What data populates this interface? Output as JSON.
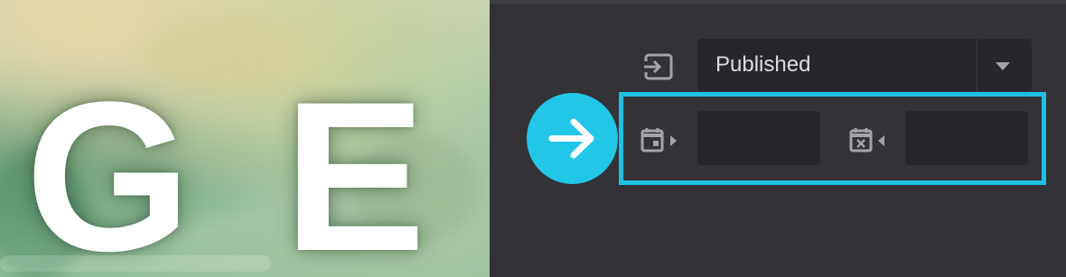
{
  "preview": {
    "letters": [
      "G",
      "E"
    ]
  },
  "status": {
    "selected_value": "Published",
    "icon": "status-exit-icon",
    "dropdown_icon": "chevron-down-icon"
  },
  "navigation": {
    "icon": "arrow-right-icon"
  },
  "schedule": {
    "start_icon": "calendar-start-icon",
    "end_icon": "calendar-end-icon",
    "start_value": "",
    "end_value": ""
  },
  "colors": {
    "accent": "#22c7e7",
    "panel_bg": "#323237",
    "field_bg": "#26272b",
    "text": "#dcdde1",
    "icon": "#a3a5ab"
  }
}
